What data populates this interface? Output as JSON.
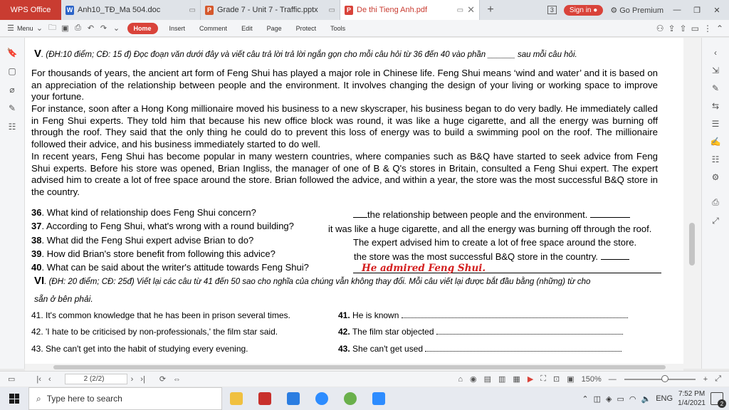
{
  "tabs": {
    "app": "WPS Office",
    "items": [
      {
        "label": "Anh10_TĐ_Ma 504.doc",
        "icon": "W",
        "color": "#2b64c8"
      },
      {
        "label": "Grade 7 - Unit 7 - Traffic.pptx",
        "icon": "P",
        "color": "#d5582c"
      },
      {
        "label": "De thi Tieng Anh.pdf",
        "icon": "P",
        "color": "#d9433a"
      }
    ],
    "add": "+",
    "count": "3",
    "signin": "Sign in",
    "premium": "Go Premium"
  },
  "menu": {
    "menu_label": "Menu",
    "items": [
      "Home",
      "Insert",
      "Comment",
      "Edit",
      "Page",
      "Protect",
      "Tools"
    ]
  },
  "document": {
    "section5_head_num": "V",
    "section5_head": ". (ĐH:10 điểm; CĐ: 15 đ)  Đọc đoạn văn dưới đây và  viết câu trả lời trả lời ngắn gọn cho mỗi câu hỏi từ  36 đến 40 vào phần ______  sau  mỗi câu hỏi.",
    "paragraphs": [
      "For thousands of years, the ancient art form of Feng Shui has played a major role in Chinese life. Feng Shui means ‘wind and water’ and it is based on an appreciation of the relationship between people and the environment. It involves changing the design of your living or working space to improve your fortune.",
      "For instance, soon after a Hong Kong millionaire moved his business to a new skyscraper, his business began to do very badly. He immediately called in Feng Shui experts. They told him that because his new office block was round, it was like a huge cigarette, and all the energy was burning off through the roof. They said that the only thing he could do to prevent this loss of energy was to build a swimming pool on the roof. The millionaire followed their advice, and his business immediately started to do well.",
      "In recent years, Feng Shui has become popular in many western countries, where companies such as B&Q have started to seek advice from Feng Shui experts. Before his store was opened, Brian Ingliss, the manager of one of B & Q's stores in Britain, consulted a Feng Shui expert. The expert advised him to create a lot of free space around the store. Brian followed the advice, and within a year, the store was the most successful B&Q store in the country."
    ],
    "questions": [
      {
        "num": "36",
        "text": ". What kind of relationship does Feng Shui concern?",
        "answer": "the relationship between people and the environment."
      },
      {
        "num": "37",
        "text": ". According to Feng Shui, what's wrong with a round building?",
        "answer": "it was like a huge cigarette, and all  the energy was burning off through the roof."
      },
      {
        "num": "38",
        "text": ". What did the Feng Shui expert advise Brian to do?",
        "answer": "The expert advised him to create a lot of free space around the store."
      },
      {
        "num": "39",
        "text": ". How did Brian's store benefit from following this advice?",
        "answer": "the store   was the most successful B&Q store in the country."
      },
      {
        "num": "40",
        "text": ". What can be said about the writer's attitude towards Feng Shui?",
        "answer": "He admired Feng Shui."
      }
    ],
    "section6_head_num": "VI",
    "section6_head_line1": ". (ĐH: 20 điểm; CĐ: 25đ) Viết lại các câu từ 41 đến 50  sao cho nghĩa của chúng vẫn không thay đổi. Mỗi câu viết lại được bắt đầu bằng  (những) từ  cho",
    "section6_head_line2": "sẵn ở  bên  phải.",
    "rewrite": [
      {
        "left": "41. It's common knowledge that he has been in prison several times.",
        "num": "41.",
        "right": "He is known"
      },
      {
        "left": "42. 'I hate to be criticised by non-professionals,' the film star said.",
        "num": "42.",
        "right": "The film star objected"
      },
      {
        "left": "43. She can't get into the habit of studying every evening.",
        "num": "43.",
        "right": "She can't get used"
      }
    ]
  },
  "status": {
    "page_value": "2",
    "page_total": "(2/2)",
    "zoom": "150%"
  },
  "taskbar": {
    "search_placeholder": "Type here to search",
    "lang": "ENG",
    "time": "7:52 PM",
    "date": "1/4/2021",
    "notifications": "2"
  }
}
